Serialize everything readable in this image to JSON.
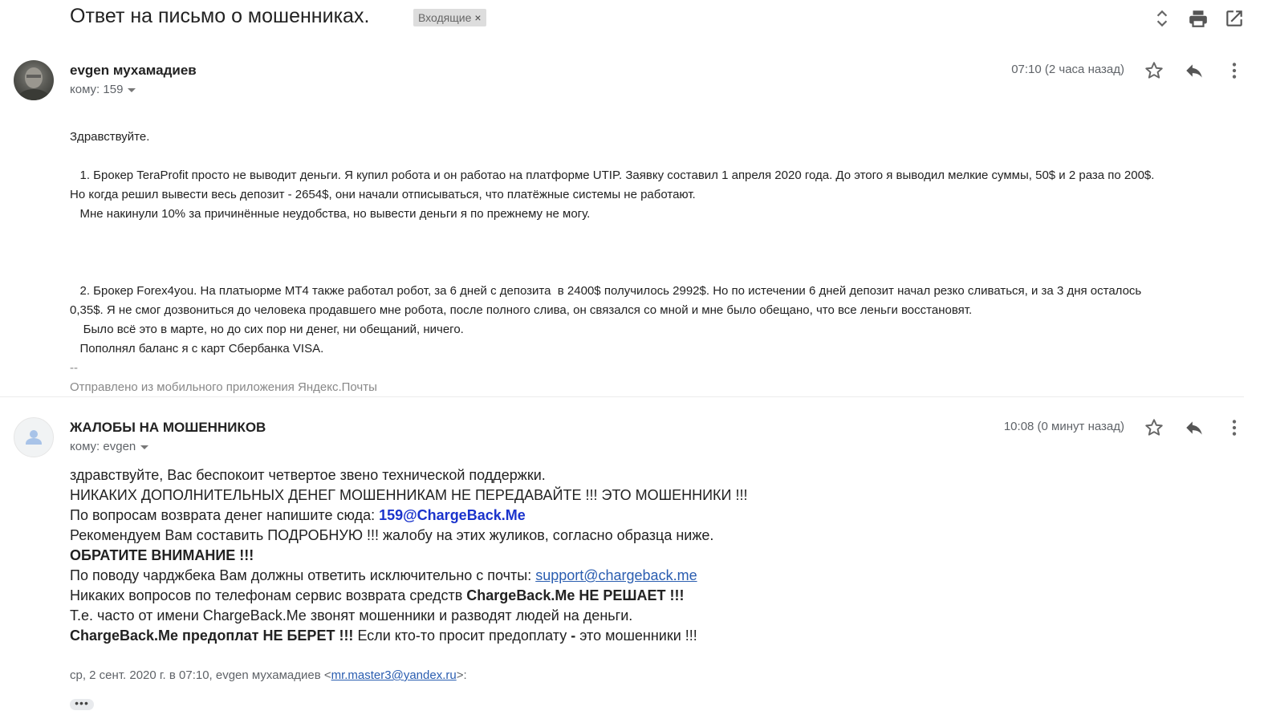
{
  "thread": {
    "subject": "Ответ на письмо о мошенниках.",
    "label": "Входящие",
    "label_close": "×",
    "icons": [
      "expand-collapse-icon",
      "print-icon",
      "open-in-new-window-icon"
    ]
  },
  "message1": {
    "sender": "evgen мухамадиев",
    "to": "кому: 159",
    "time": "07:10 (2 часа назад)",
    "lines": [
      "Здравствуйте.",
      "",
      "   1. Брокер TeraProfit просто не выводит деньги. Я купил робота и он работао на платформе UTIP. Заявку составил 1 апреля 2020 года. До этого я выводил мелкие суммы, 50$ и 2 раза по 200$.",
      "Но когда решил вывести весь депозит - 2654$, они начали отписываться, что платёжные системы не работают.",
      "   Мне накинули 10% за причинённые неудобства, но вывести деньги я по прежнему не могу.",
      "",
      "",
      "",
      "   2. Брокер Forex4you. На платыорме МТ4 также работал робот, за 6 дней с депозита  в 2400$ получилось 2992$. Но по истечении 6 дней депозит начал резко сливаться, и за 3 дня осталось",
      "0,35$. Я не смог дозвониться до человека продавшего мне робота, после полного слива, он связался со мной и мне было обещано, что все леньги восстановят.",
      "    Было всё это в марте, но до сих пор ни денег, ни обещаний, ничего.",
      "   Пополнял баланс я с карт Сбербанка VISA.",
      "--",
      "Отправлено из мобильного приложения Яндекс.Почты"
    ]
  },
  "message2": {
    "sender": "ЖАЛОБЫ НА МОШЕННИКОВ",
    "to": "кому: evgen",
    "time": "10:08 (0 минут назад)",
    "line1": "здравствуйте, Вас беспокоит четвертое звено технической поддержки.",
    "line2": "НИКАКИХ ДОПОЛНИТЕЛЬНЫХ ДЕНЕГ МОШЕННИКАМ НЕ ПЕРЕДАВАЙТЕ !!! ЭТО МОШЕННИКИ !!!",
    "line3_text": "По вопросам возврата денег напишите сюда: ",
    "line3_email": "159@ChargeBack.Me",
    "line4": "Рекомендуем Вам составить ПОДРОБНУЮ !!! жалобу на этих жуликов, согласно образца ниже.",
    "line5": "ОБРАТИТЕ ВНИМАНИЕ !!!",
    "line6_text": "По поводу чарджбека Вам должны ответить исключительно с почты: ",
    "line6_email": "support@chargeback.me",
    "line7_text": "Никаких вопросов по телефонам сервис возврата средств ",
    "line7_bold": "ChargeBack.Me НЕ РЕШАЕТ !!!",
    "line8": "Т.е. часто от имени ChargeBack.Me звонят мошенники и разводят людей на деньги.",
    "line9_bold": "ChargeBack.Me предоплат НЕ БЕРЕТ !!!",
    "line9_text": " Если кто-то просит предоплату ",
    "line9_dash": "-",
    "line9_tail": " это мошенники !!!",
    "quote_prefix": "ср, 2 сент. 2020 г. в 07:10, evgen мухамадиев <",
    "quote_email": "mr.master3@yandex.ru",
    "quote_suffix": ">:",
    "show_trimmed": "•••"
  },
  "colors": {
    "link": "#2a5db0",
    "email_highlight": "#1a33cc",
    "muted": "#5f6368",
    "label_bg": "#dddddd"
  }
}
